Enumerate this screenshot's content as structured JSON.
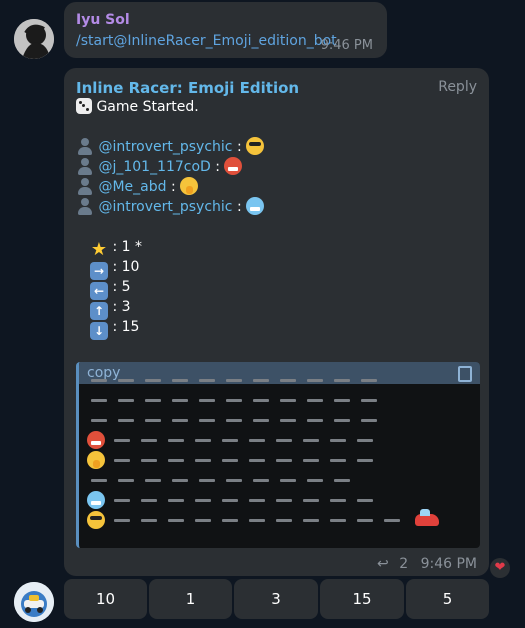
{
  "message1": {
    "sender": "Iyu Sol",
    "text": "/start@InlineRacer_Emoji_edition_bot",
    "time": "9:46 PM"
  },
  "message2": {
    "sender": "Inline Racer: Emoji Edition",
    "reply_label": "Reply",
    "game_started": "Game Started.",
    "players": [
      {
        "mention": "@introvert_psychic",
        "sep": " : ",
        "emoji_icon": "cool-face"
      },
      {
        "mention": "@j_101_117coD",
        "sep": " : ",
        "emoji_icon": "angry-face"
      },
      {
        "mention": "@Me_abd",
        "sep": " : ",
        "emoji_icon": "shushing-face"
      },
      {
        "mention": "@introvert_psychic",
        "sep": " : ",
        "emoji_icon": "cold-face"
      }
    ],
    "stats": [
      {
        "icon": "star-icon",
        "text": ": 1 *"
      },
      {
        "icon": "right-arrow-icon",
        "text": ": 10"
      },
      {
        "icon": "left-arrow-icon",
        "text": ": 5"
      },
      {
        "icon": "up-arrow-icon",
        "text": ": 3"
      },
      {
        "icon": "down-arrow-icon",
        "text": ": 15"
      }
    ],
    "code_lang": "copy",
    "replies": "2",
    "time": "9:46 PM"
  },
  "reaction": "❤",
  "keyboard": [
    "10",
    "1",
    "3",
    "15",
    "5"
  ]
}
